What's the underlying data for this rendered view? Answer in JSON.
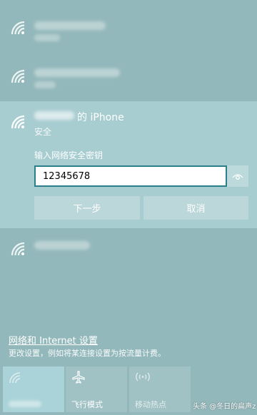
{
  "networks_above": [
    {
      "icon": "wifi-signal-icon"
    },
    {
      "icon": "wifi-signal-icon"
    }
  ],
  "selected_network": {
    "name_suffix": "的 iPhone",
    "status": "安全",
    "key_label": "输入网络安全密钥",
    "password_value": "12345678",
    "next_label": "下一步",
    "cancel_label": "取消"
  },
  "networks_below": [
    {
      "icon": "wifi-signal-icon"
    }
  ],
  "settings": {
    "link": "网络和 Internet 设置",
    "description": "更改设置，例如将某连接设置为按流量计费。"
  },
  "quick_actions": [
    {
      "label": "",
      "icon": "wifi-icon",
      "active": true
    },
    {
      "label": "飞行模式",
      "icon": "airplane-icon",
      "active": false
    },
    {
      "label": "移动热点",
      "icon": "hotspot-icon",
      "active": false
    }
  ],
  "watermark": "头条 @冬日的扁声z",
  "colors": {
    "panel_bg": "#93b8bb",
    "expanded_bg": "#a8cdd1",
    "button_bg": "#bbd7da",
    "input_border": "#2a7f8a"
  }
}
